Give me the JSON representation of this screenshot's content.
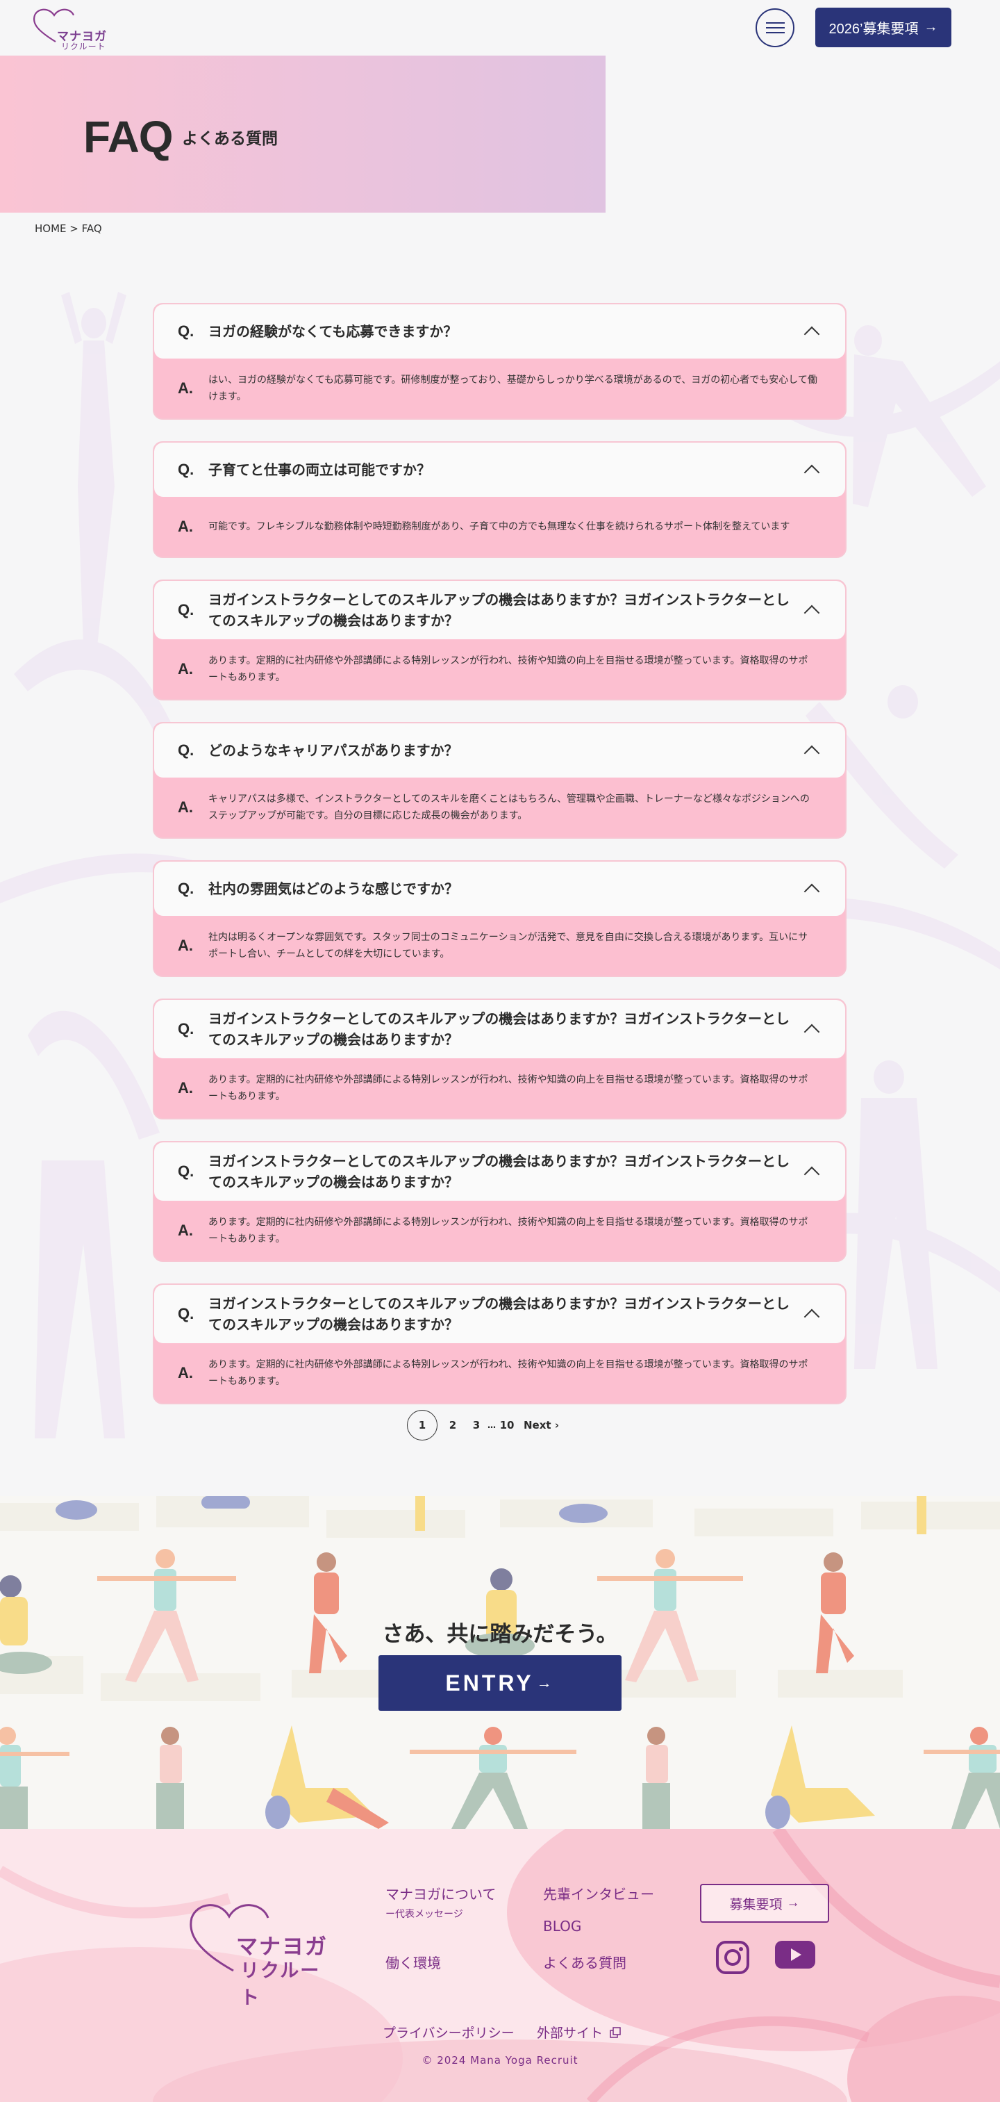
{
  "header": {
    "logo_text_main": "マナヨガ",
    "logo_text_sub": "リクルート",
    "recruit_button": "2026’募集要項",
    "recruit_arrow": "→"
  },
  "hero": {
    "title": "FAQ",
    "subtitle": "よくある質問"
  },
  "breadcrumb": {
    "home": "HOME",
    "separator": " > ",
    "current": "FAQ"
  },
  "faq": {
    "q_mark": "Q.",
    "a_mark": "A.",
    "items": [
      {
        "question": "ヨガの経験がなくても応募できますか？",
        "answer": "はい、ヨガの経験がなくても応募可能です。研修制度が整っており、基礎からしっかり学べる環境があるので、ヨガの初心者でも安心して働けます。"
      },
      {
        "question": "子育てと仕事の両立は可能ですか？",
        "answer": "可能です。フレキシブルな勤務体制や時短勤務制度があり、子育て中の方でも無理なく仕事を続けられるサポート体制を整えています"
      },
      {
        "question": "ヨガインストラクターとしてのスキルアップの機会はありますか？ヨガインストラクターとしてのスキルアップの機会はありますか？",
        "answer": "あります。定期的に社内研修や外部講師による特別レッスンが行われ、技術や知識の向上を目指せる環境が整っています。資格取得のサポートもあります。"
      },
      {
        "question": "どのようなキャリアパスがありますか？",
        "answer": "キャリアパスは多様で、インストラクターとしてのスキルを磨くことはもちろん、管理職や企画職、トレーナーなど様々なポジションへのステップアップが可能です。自分の目標に応じた成長の機会があります。"
      },
      {
        "question": "社内の雰囲気はどのような感じですか？",
        "answer": "社内は明るくオープンな雰囲気です。スタッフ同士のコミュニケーションが活発で、意見を自由に交換し合える環境があります。互いにサポートし合い、チームとしての絆を大切にしています。"
      },
      {
        "question": "ヨガインストラクターとしてのスキルアップの機会はありますか？ヨガインストラクターとしてのスキルアップの機会はありますか？",
        "answer": "あります。定期的に社内研修や外部講師による特別レッスンが行われ、技術や知識の向上を目指せる環境が整っています。資格取得のサポートもあります。"
      },
      {
        "question": "ヨガインストラクターとしてのスキルアップの機会はありますか？ヨガインストラクターとしてのスキルアップの機会はありますか？",
        "answer": "あります。定期的に社内研修や外部講師による特別レッスンが行われ、技術や知識の向上を目指せる環境が整っています。資格取得のサポートもあります。"
      },
      {
        "question": "ヨガインストラクターとしてのスキルアップの機会はありますか？ヨガインストラクターとしてのスキルアップの機会はありますか？",
        "answer": "あります。定期的に社内研修や外部講師による特別レッスンが行われ、技術や知識の向上を目指せる環境が整っています。資格取得のサポートもあります。"
      }
    ]
  },
  "pagination": {
    "pages": [
      "1",
      "2",
      "3"
    ],
    "current": "1",
    "ellipsis": "…",
    "last": "10",
    "next": "Next"
  },
  "entry": {
    "catch": "さあ、共に踏みだそう。",
    "button": "ENTRY",
    "arrow": "→"
  },
  "footer": {
    "logo_text_main": "マナヨガ",
    "logo_text_sub": "リクルート",
    "links": {
      "about": "マナヨガについて",
      "about_sub": "ー代表メッセージ",
      "interview": "先輩インタビュー",
      "blog": "BLOG",
      "environment": "働く環境",
      "faq": "よくある質問"
    },
    "recruit_button": "募集要項",
    "recruit_arrow": "→",
    "privacy": "プライバシーポリシー",
    "external": "外部サイト",
    "copyright": "© 2024 Mana Yoga  Recruit"
  },
  "colors": {
    "navy": "#2a3479",
    "pink": "#fcbfd0",
    "purple": "#7a2d86",
    "hero_gradient_start": "#fac4d3",
    "hero_gradient_end": "#e0c3e1"
  }
}
